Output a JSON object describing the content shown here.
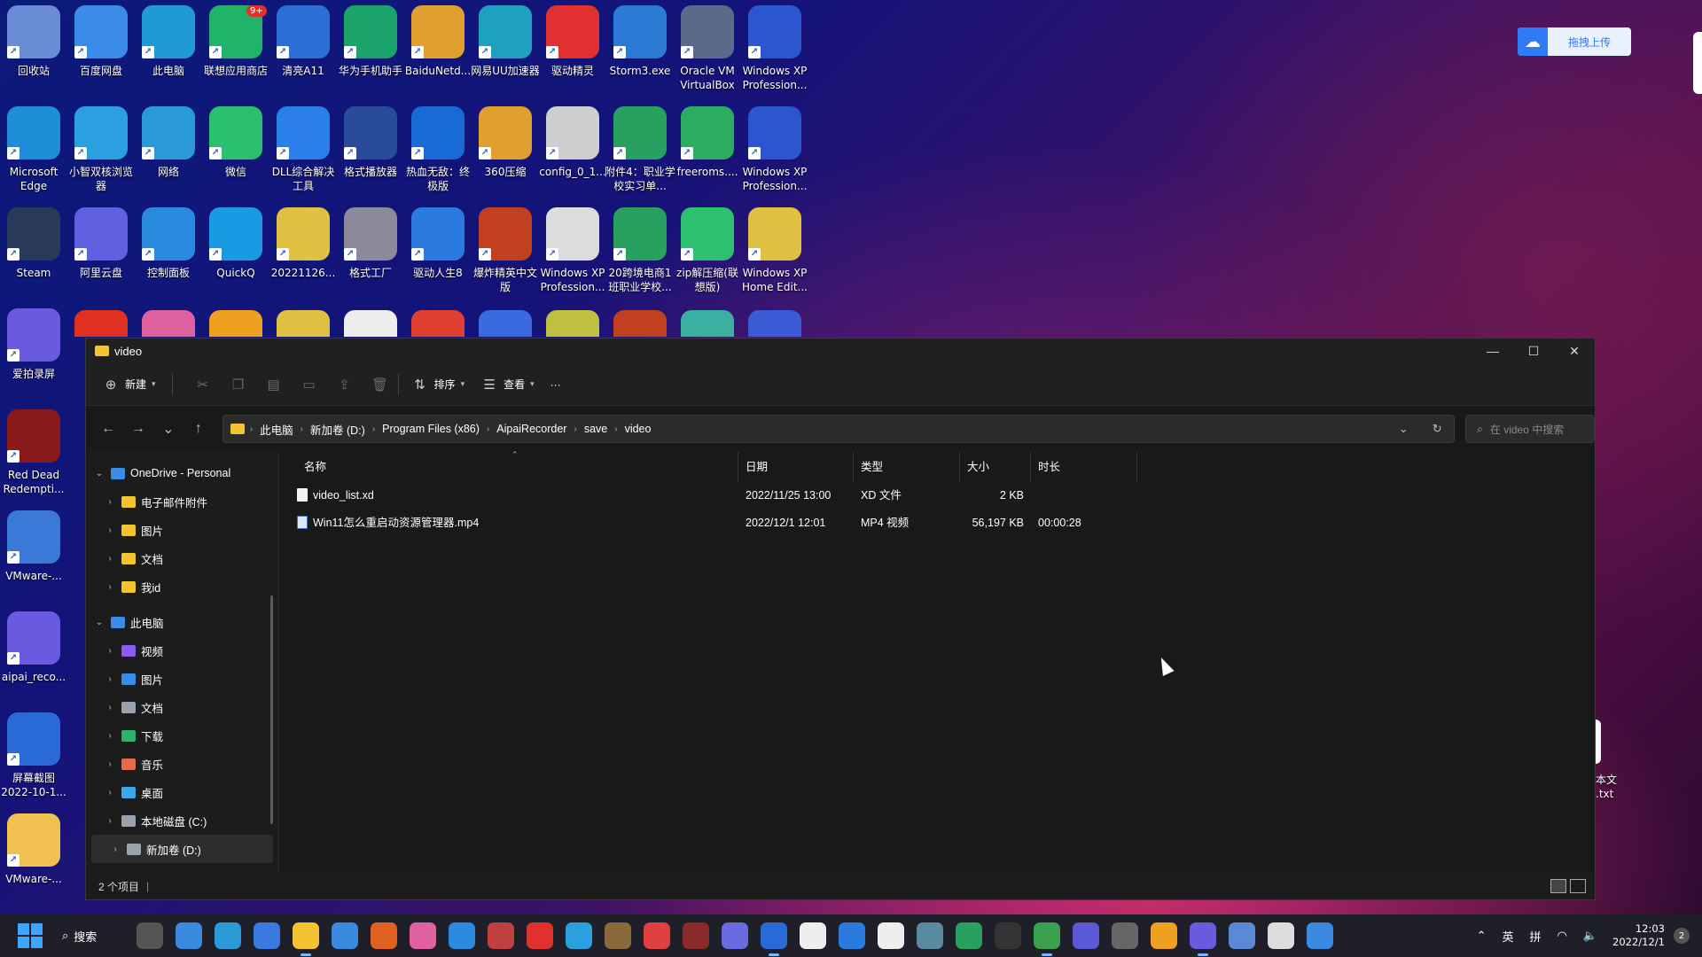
{
  "desktop": {
    "row1": [
      "回收站",
      "百度网盘",
      "此电脑",
      "联想应用商店",
      "清亮A11",
      "华为手机助手",
      "BaiduNetd...",
      "网易UU加速器",
      "驱动精灵",
      "Storm3.exe",
      "Oracle VM VirtualBox",
      "Windows XP Profession..."
    ],
    "row2": [
      "Microsoft Edge",
      "小智双核浏览器",
      "网络",
      "微信",
      "DLL综合解决工具",
      "格式播放器",
      "热血无敌：终极版",
      "360压缩",
      "config_0_1...",
      "附件4：职业学校实习单...",
      "freeroms....",
      "Windows XP Profession..."
    ],
    "row3": [
      "Steam",
      "阿里云盘",
      "控制面板",
      "QuickQ",
      "20221126...",
      "格式工厂",
      "驱动人生8",
      "爆炸精英中文版",
      "Windows XP Profession...",
      "20跨境电商1班职业学校...",
      "zip解压缩(联想版)",
      "Windows XP Home Edit..."
    ],
    "left_col": [
      "爱拍录屏",
      "Red Dead Redempti...",
      "VMware-...",
      "aipai_reco...",
      "屏幕截图 2022-10-1...",
      "VMware-..."
    ],
    "badge": "9+",
    "right_partial_label": "本文\n.txt"
  },
  "upload_button": {
    "label": "拖拽上传"
  },
  "window": {
    "title": "video",
    "controls": {
      "minimize": "—",
      "maximize": "☐",
      "close": "✕"
    }
  },
  "toolbar": {
    "new_label": "新建",
    "sort_label": "排序",
    "view_label": "查看",
    "more_label": "···"
  },
  "address": {
    "crumbs": [
      "此电脑",
      "新加卷 (D:)",
      "Program Files (x86)",
      "AipaiRecorder",
      "save",
      "video"
    ],
    "search_placeholder": "在 video 中搜索"
  },
  "sidebar": {
    "items": [
      {
        "label": "OneDrive - Personal",
        "expanded": true,
        "color": "#3b8be8"
      },
      {
        "label": "电子邮件附件",
        "color": "#f4c430"
      },
      {
        "label": "图片",
        "color": "#f4c430"
      },
      {
        "label": "文档",
        "color": "#f4c430"
      },
      {
        "label": "我id",
        "color": "#f4c430"
      },
      {
        "label": "此电脑",
        "expanded": true,
        "color": "#3b8be8"
      },
      {
        "label": "视频",
        "color": "#8a5cf6"
      },
      {
        "label": "图片",
        "color": "#3b8be8"
      },
      {
        "label": "文档",
        "color": "#9aa3ad"
      },
      {
        "label": "下载",
        "color": "#2fb36a"
      },
      {
        "label": "音乐",
        "color": "#e36a4a"
      },
      {
        "label": "桌面",
        "color": "#3ba8e8"
      },
      {
        "label": "本地磁盘 (C:)",
        "color": "#9aa3ad"
      },
      {
        "label": "新加卷 (D:)",
        "color": "#9aa3ad",
        "selected": true
      }
    ]
  },
  "columns": {
    "name": "名称",
    "date": "日期",
    "type": "类型",
    "size": "大小",
    "duration": "时长"
  },
  "files": [
    {
      "name": "video_list.xd",
      "date": "2022/11/25 13:00",
      "type": "XD 文件",
      "size": "2 KB",
      "duration": ""
    },
    {
      "name": "Win11怎么重启动资源管理器.mp4",
      "date": "2022/12/1 12:01",
      "type": "MP4 视频",
      "size": "56,197 KB",
      "duration": "00:00:28"
    }
  ],
  "status": {
    "count": "2 个项目"
  },
  "taskbar": {
    "search_label": "搜索",
    "tray_ime1": "英",
    "tray_ime2": "拼",
    "time": "12:03",
    "date": "2022/12/1",
    "notification_count": "2"
  }
}
